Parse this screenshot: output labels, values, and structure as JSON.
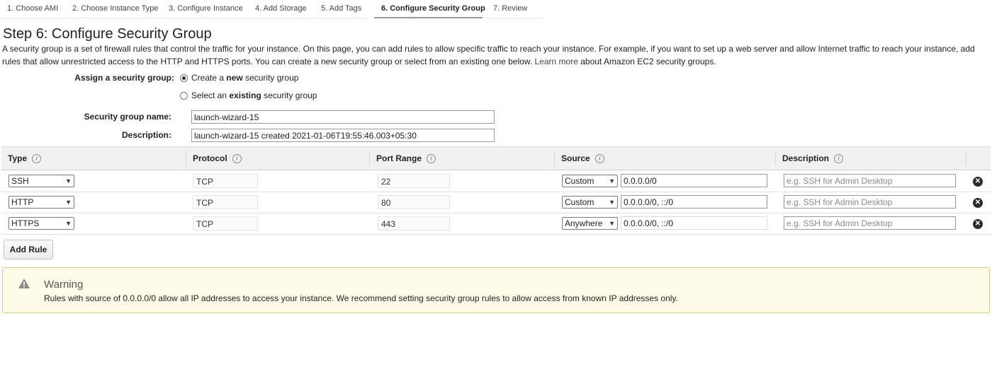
{
  "wizard": {
    "steps": [
      "1. Choose AMI",
      "2. Choose Instance Type",
      "3. Configure Instance",
      "4. Add Storage",
      "5. Add Tags",
      "6. Configure Security Group",
      "7. Review"
    ],
    "active_step": 5
  },
  "page": {
    "title": "Step 6: Configure Security Group",
    "intro_before_link": "A security group is a set of firewall rules that control the traffic for your instance. On this page, you can add rules to allow specific traffic to reach your instance. For example, if you want to set up a web server and allow Internet traffic to reach your instance, add rules that allow unrestricted access to the HTTP and HTTPS ports. You can create a new security group or select from an existing one below.",
    "learn_more": "Learn more",
    "intro_after_link": "about Amazon EC2 security groups."
  },
  "assign": {
    "label": "Assign a security group:",
    "option_new_prefix": "Create a",
    "option_new_bold": "new",
    "option_new_suffix": "security group",
    "option_existing_prefix": "Select an",
    "option_existing_bold": "existing",
    "option_existing_suffix": "security group",
    "selected": "new"
  },
  "form": {
    "name_label": "Security group name:",
    "name_value": "launch-wizard-15",
    "description_label": "Description:",
    "description_value": "launch-wizard-15 created 2021-01-06T19:55:46.003+05:30"
  },
  "rules_table": {
    "headers": {
      "type": "Type",
      "protocol": "Protocol",
      "port_range": "Port Range",
      "source": "Source",
      "description": "Description"
    },
    "rows": [
      {
        "type": "SSH",
        "protocol": "TCP",
        "port": "22",
        "source_mode": "Custom",
        "cidr": "0.0.0.0/0",
        "description_placeholder": "e.g. SSH for Admin Desktop"
      },
      {
        "type": "HTTP",
        "protocol": "TCP",
        "port": "80",
        "source_mode": "Custom",
        "cidr": "0.0.0.0/0, ::/0",
        "description_placeholder": "e.g. SSH for Admin Desktop"
      },
      {
        "type": "HTTPS",
        "protocol": "TCP",
        "port": "443",
        "source_mode": "Anywhere",
        "cidr": "0.0.0.0/0, ::/0",
        "description_placeholder": "e.g. SSH for Admin Desktop"
      }
    ],
    "add_rule_label": "Add Rule"
  },
  "warning": {
    "title": "Warning",
    "text": "Rules with source of 0.0.0.0/0 allow all IP addresses to access your instance. We recommend setting security group rules to allow access from known IP addresses only."
  },
  "icons": {
    "info": "info-icon",
    "remove": "remove-rule-icon",
    "warning": "warning-triangle-icon",
    "dropdown": "chevron-down-icon"
  }
}
